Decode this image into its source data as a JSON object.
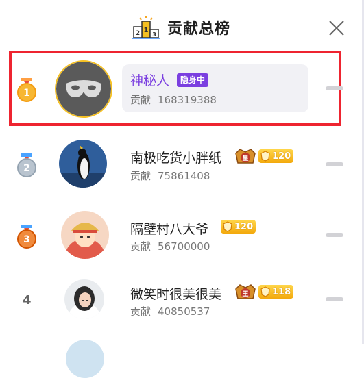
{
  "header": {
    "title": "贡献总榜",
    "icon": "podium-icon",
    "close_icon": "close-icon"
  },
  "colors": {
    "highlight_border": "#ee2430",
    "accent_purple": "#7b3fe0",
    "level_badge": "#f3a90c"
  },
  "contrib_label": "贡献",
  "rows": [
    {
      "rank": "1",
      "name": "神秘人",
      "badge": "隐身中",
      "contribution": "168319388",
      "avatar": "mystery-mask-avatar"
    },
    {
      "rank": "2",
      "name": "南极吃货小胖纸",
      "crown_text": "皇",
      "level": "120",
      "contribution": "75861408",
      "avatar": "penguin-avatar"
    },
    {
      "rank": "3",
      "name": "隔壁村八大爷",
      "level": "120",
      "contribution": "56700000",
      "avatar": "cartoon-avatar"
    },
    {
      "rank": "4",
      "name": "微笑时很美很美",
      "crown_text": "王",
      "level": "118",
      "contribution": "40850537",
      "avatar": "girl-avatar"
    }
  ]
}
